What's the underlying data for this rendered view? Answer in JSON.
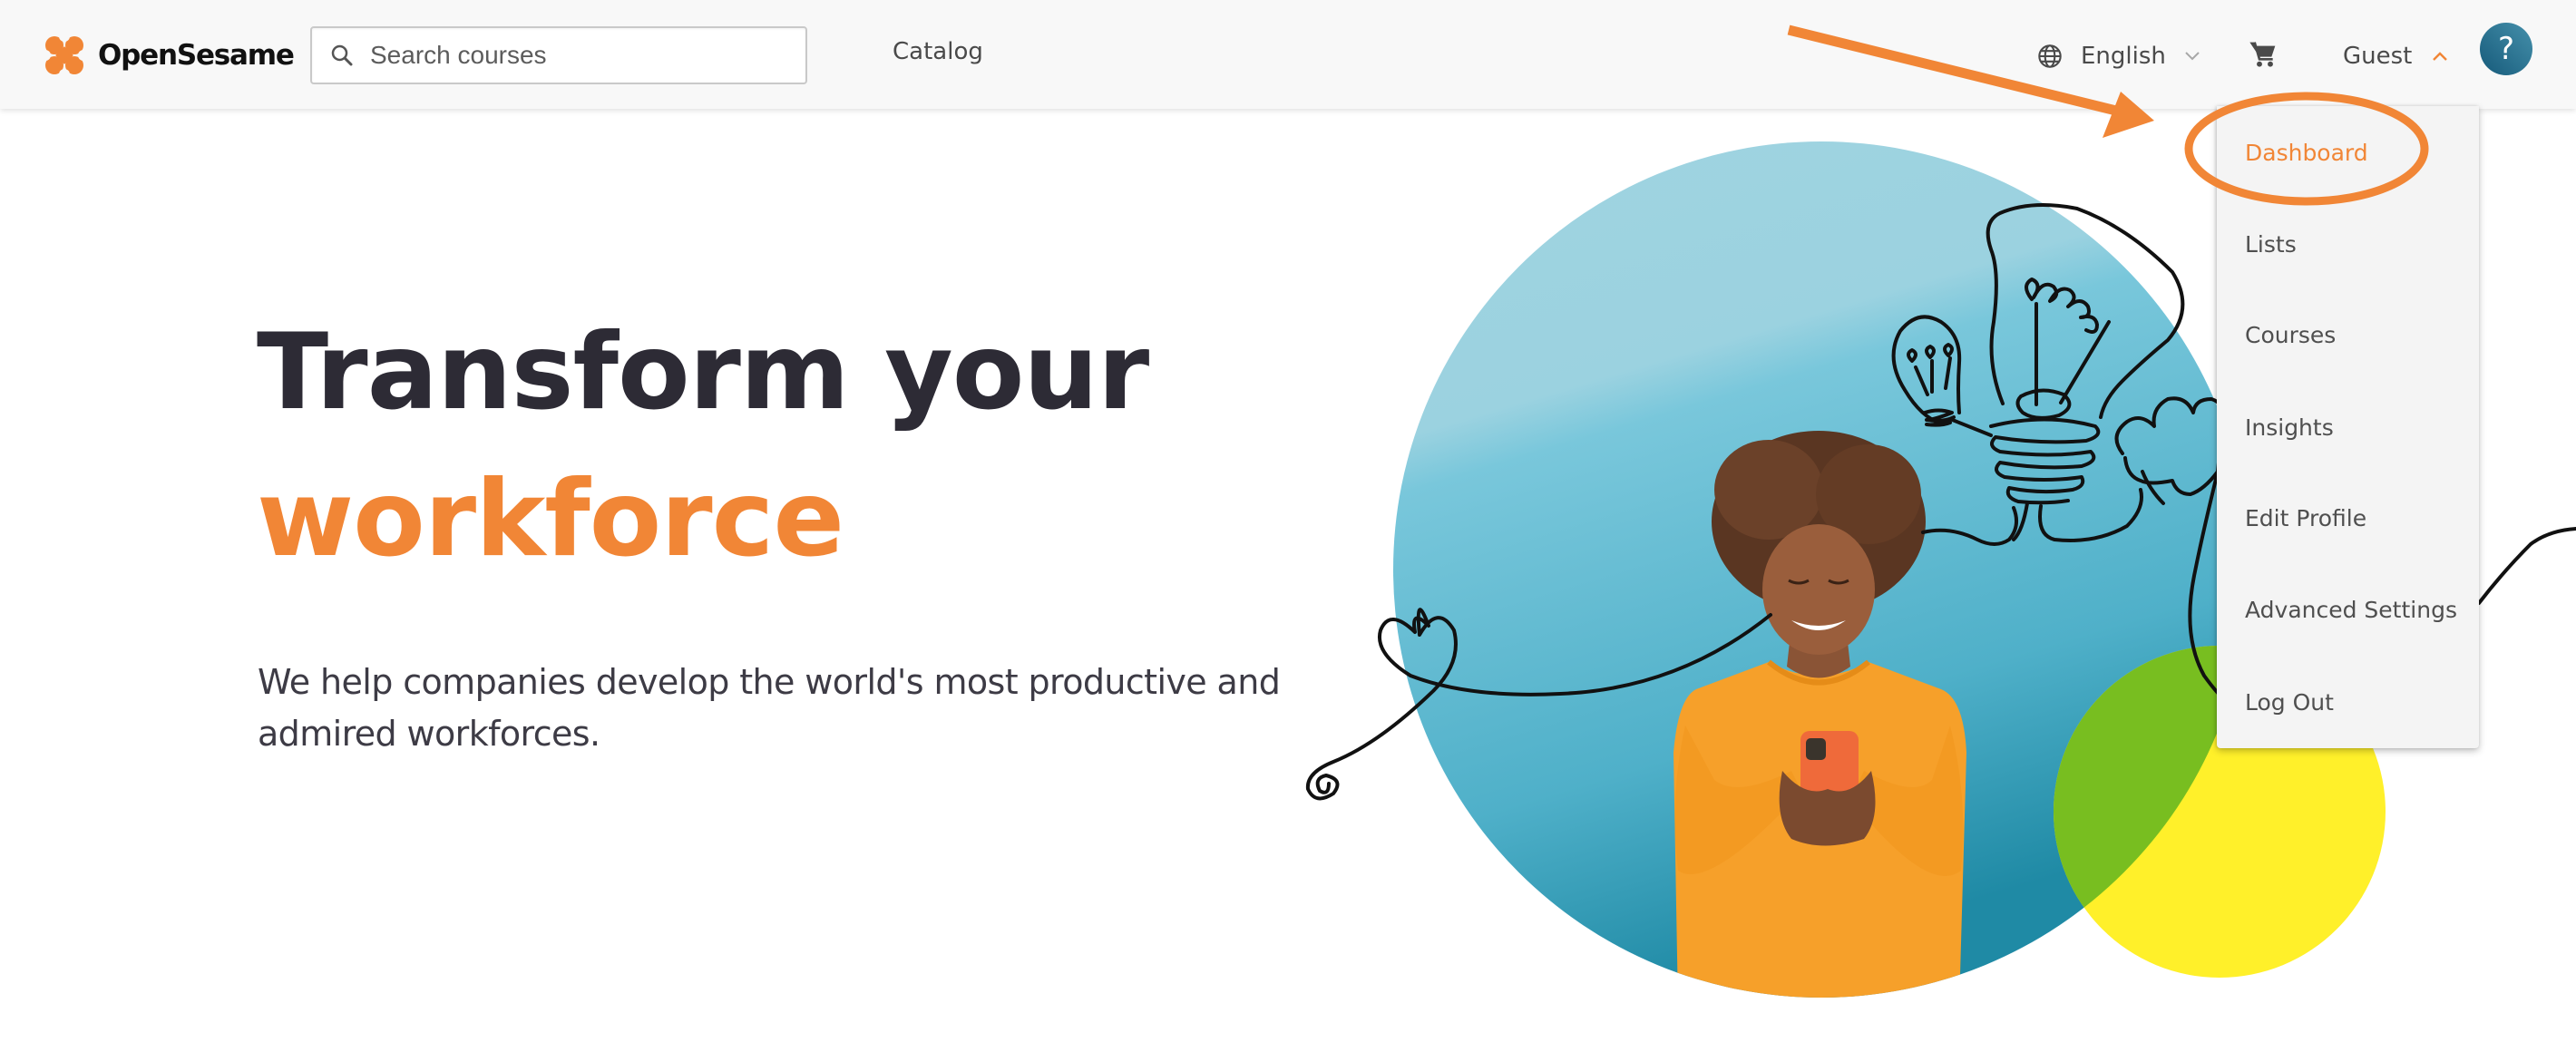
{
  "header": {
    "brand": "OpenSesame",
    "search": {
      "placeholder": "Search courses",
      "value": ""
    },
    "nav": {
      "catalog": "Catalog"
    },
    "language": {
      "label": "English",
      "icon": "globe-icon"
    },
    "cart": {
      "icon": "shopping-cart-icon"
    },
    "user": {
      "label": "Guest",
      "menu_open": true
    },
    "help": {
      "label": "?"
    }
  },
  "user_menu": {
    "items": [
      {
        "label": "Dashboard",
        "active": true
      },
      {
        "label": "Lists",
        "active": false
      },
      {
        "label": "Courses",
        "active": false
      },
      {
        "label": "Insights",
        "active": false
      },
      {
        "label": "Edit Profile",
        "active": false
      },
      {
        "label": "Advanced Settings",
        "active": false
      },
      {
        "label": "Log Out",
        "active": false
      }
    ]
  },
  "hero": {
    "title_line1": "Transform your",
    "title_line2": "workforce",
    "subtitle": "We help companies develop the world's most productive and admired workforces."
  },
  "annotation": {
    "type": "arrow-and-ellipse",
    "target": "Dashboard",
    "color": "#F18636"
  },
  "colors": {
    "brand_orange": "#F18636",
    "heading_dark": "#2D2B35",
    "help_teal": "#1B5F7E",
    "circle_blue": "#6CBFD6",
    "circle_yellow": "#FFF02A",
    "circle_green": "#78BE20"
  }
}
